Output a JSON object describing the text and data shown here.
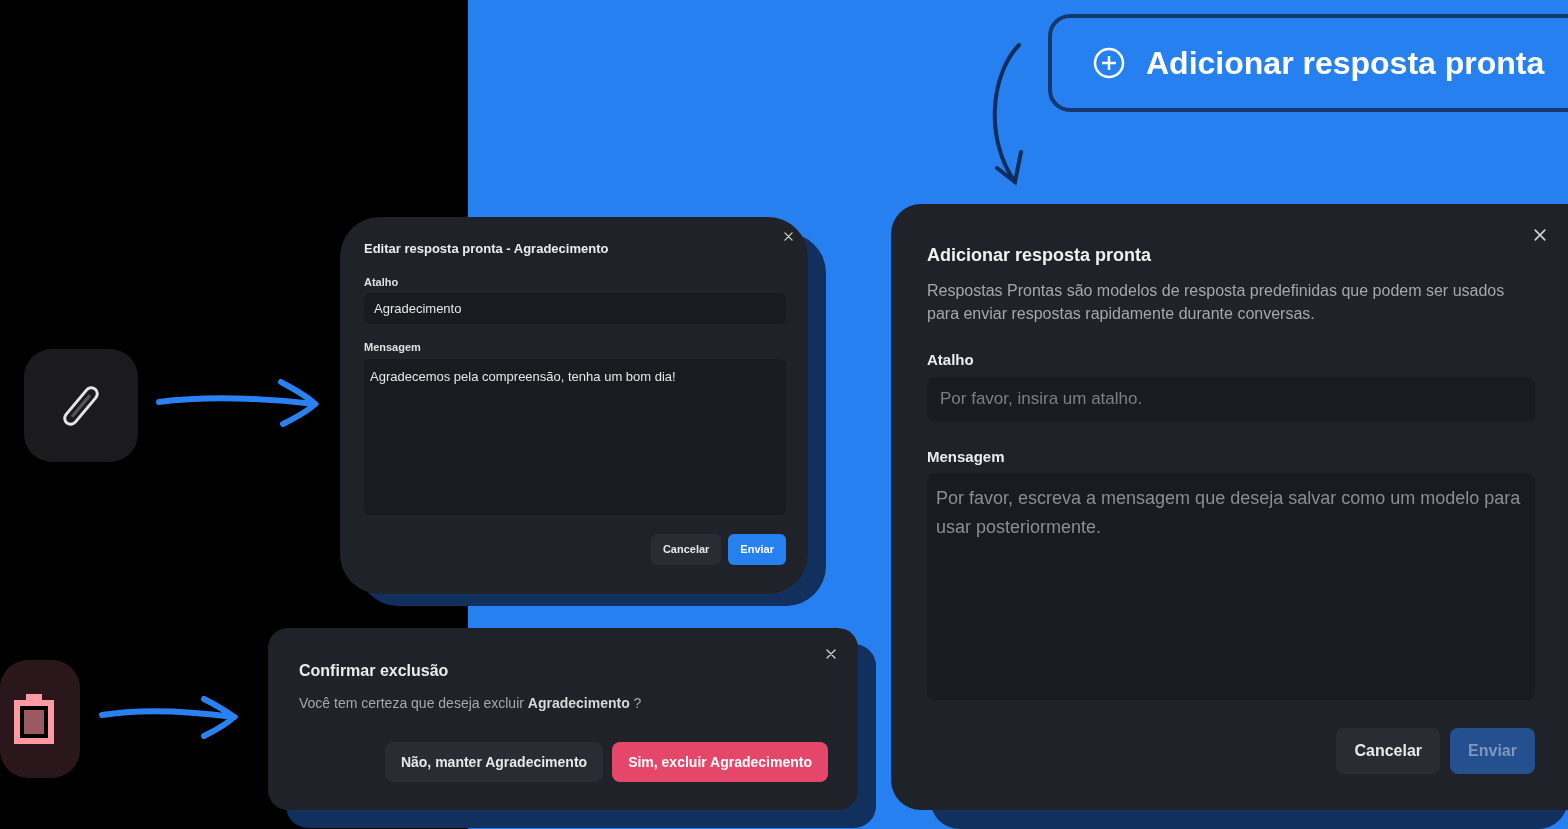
{
  "add_button": {
    "label": "Adicionar resposta pronta"
  },
  "edit_dialog": {
    "title": "Editar resposta pronta - Agradecimento",
    "fields": [
      {
        "kind": "input",
        "label": "Atalho",
        "value": "Agradecimento"
      },
      {
        "kind": "textarea",
        "label": "Mensagem",
        "value": "Agradecemos pela compreensão, tenha um bom dia!"
      }
    ],
    "buttons": [
      {
        "kind": "secondary",
        "label": "Cancelar",
        "disabled": false
      },
      {
        "kind": "primary",
        "label": "Enviar",
        "disabled": false
      }
    ]
  },
  "delete_dialog": {
    "title": "Confirmar exclusão",
    "message": "Você tem certeza que deseja excluir **Agradecimento** ?",
    "buttons": [
      {
        "kind": "secondary",
        "label": "Não, manter Agradecimento",
        "disabled": false
      },
      {
        "kind": "danger",
        "label": "Sim, excluir Agradecimento",
        "disabled": false
      }
    ]
  },
  "add_dialog": {
    "title": "Adicionar resposta pronta",
    "description": "Respostas Prontas são modelos de resposta predefinidas que podem ser usados para enviar respostas rapidamente durante conversas.",
    "fields": [
      {
        "kind": "input",
        "label": "Atalho",
        "placeholder": "Por favor, insira um atalho."
      },
      {
        "kind": "textarea",
        "label": "Mensagem",
        "placeholder": "Por favor, escreva a mensagem que deseja salvar como um modelo para usar posteriormente."
      }
    ],
    "buttons": [
      {
        "kind": "secondary",
        "label": "Cancelar",
        "disabled": false
      },
      {
        "kind": "primary",
        "label": "Enviar",
        "disabled": true
      }
    ]
  }
}
